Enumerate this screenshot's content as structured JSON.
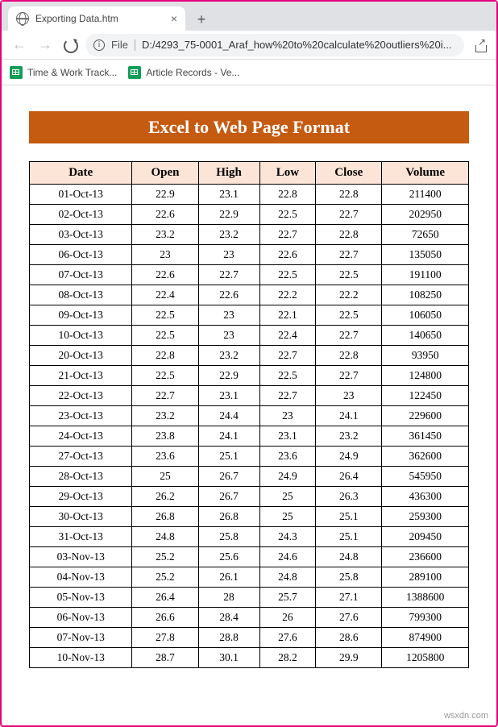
{
  "browser": {
    "tab_title": "Exporting Data.htm",
    "url_scheme": "File",
    "url_path": "D:/4293_75-0001_Araf_how%20to%20calculate%20outliers%20i...",
    "bookmarks": [
      {
        "label": "Time & Work Track..."
      },
      {
        "label": "Article Records - Ve..."
      }
    ]
  },
  "page": {
    "title": "Excel to Web Page Format",
    "columns": [
      "Date",
      "Open",
      "High",
      "Low",
      "Close",
      "Volume"
    ],
    "rows": [
      [
        "01-Oct-13",
        "22.9",
        "23.1",
        "22.8",
        "22.8",
        "211400"
      ],
      [
        "02-Oct-13",
        "22.6",
        "22.9",
        "22.5",
        "22.7",
        "202950"
      ],
      [
        "03-Oct-13",
        "23.2",
        "23.2",
        "22.7",
        "22.8",
        "72650"
      ],
      [
        "06-Oct-13",
        "23",
        "23",
        "22.6",
        "22.7",
        "135050"
      ],
      [
        "07-Oct-13",
        "22.6",
        "22.7",
        "22.5",
        "22.5",
        "191100"
      ],
      [
        "08-Oct-13",
        "22.4",
        "22.6",
        "22.2",
        "22.2",
        "108250"
      ],
      [
        "09-Oct-13",
        "22.5",
        "23",
        "22.1",
        "22.5",
        "106050"
      ],
      [
        "10-Oct-13",
        "22.5",
        "23",
        "22.4",
        "22.7",
        "140650"
      ],
      [
        "20-Oct-13",
        "22.8",
        "23.2",
        "22.7",
        "22.8",
        "93950"
      ],
      [
        "21-Oct-13",
        "22.5",
        "22.9",
        "22.5",
        "22.7",
        "124800"
      ],
      [
        "22-Oct-13",
        "22.7",
        "23.1",
        "22.7",
        "23",
        "122450"
      ],
      [
        "23-Oct-13",
        "23.2",
        "24.4",
        "23",
        "24.1",
        "229600"
      ],
      [
        "24-Oct-13",
        "23.8",
        "24.1",
        "23.1",
        "23.2",
        "361450"
      ],
      [
        "27-Oct-13",
        "23.6",
        "25.1",
        "23.6",
        "24.9",
        "362600"
      ],
      [
        "28-Oct-13",
        "25",
        "26.7",
        "24.9",
        "26.4",
        "545950"
      ],
      [
        "29-Oct-13",
        "26.2",
        "26.7",
        "25",
        "26.3",
        "436300"
      ],
      [
        "30-Oct-13",
        "26.8",
        "26.8",
        "25",
        "25.1",
        "259300"
      ],
      [
        "31-Oct-13",
        "24.8",
        "25.8",
        "24.3",
        "25.1",
        "209450"
      ],
      [
        "03-Nov-13",
        "25.2",
        "25.6",
        "24.6",
        "24.8",
        "236600"
      ],
      [
        "04-Nov-13",
        "25.2",
        "26.1",
        "24.8",
        "25.8",
        "289100"
      ],
      [
        "05-Nov-13",
        "26.4",
        "28",
        "25.7",
        "27.1",
        "1388600"
      ],
      [
        "06-Nov-13",
        "26.6",
        "28.4",
        "26",
        "27.6",
        "799300"
      ],
      [
        "07-Nov-13",
        "27.8",
        "28.8",
        "27.6",
        "28.6",
        "874900"
      ],
      [
        "10-Nov-13",
        "28.7",
        "30.1",
        "28.2",
        "29.9",
        "1205800"
      ]
    ]
  },
  "watermark": "wsxdn.com"
}
